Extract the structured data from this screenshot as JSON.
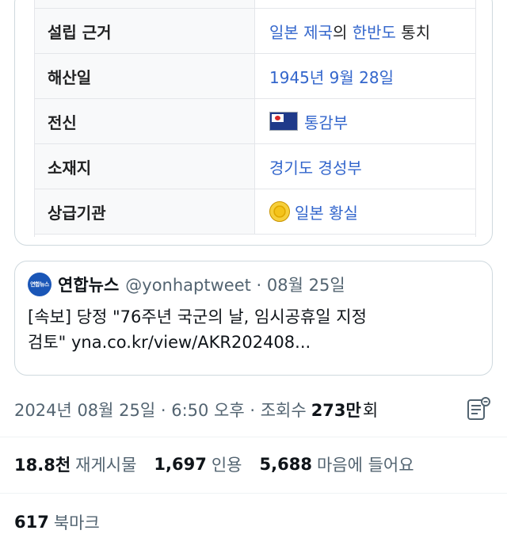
{
  "infobox": {
    "rows": [
      {
        "key": "",
        "value": ""
      },
      {
        "key": "설립 근거",
        "value_parts": [
          "일본 제국",
          "의 ",
          "한반도",
          " 통치"
        ]
      },
      {
        "key": "해산일",
        "value": "1945년 9월 28일"
      },
      {
        "key": "전신",
        "value": "통감부",
        "icon": "flag-icon"
      },
      {
        "key": "소재지",
        "value": "경기도 경성부"
      },
      {
        "key": "상급기관",
        "value": "일본 황실",
        "icon": "imperial-seal-icon"
      }
    ]
  },
  "quote_tweet": {
    "avatar_text": "연합뉴스",
    "name": "연합뉴스",
    "handle_time": "@yonhaptweet · 08월 25일",
    "text_line1": "[속보] 당정 \"76주년 국군의 날, 임시공휴일 지정",
    "text_line2": "검토\" yna.co.kr/view/AKR202408..."
  },
  "meta": {
    "datetime": "2024년 08월 25일 · 6:50 오후 · 조회수",
    "views_num": "273만",
    "views_unit": "회"
  },
  "stats": {
    "retweets_num": "18.8천",
    "retweets_label": "재게시물",
    "quotes_num": "1,697",
    "quotes_label": "인용",
    "likes_num": "5,688",
    "likes_label": "마음에 들어요"
  },
  "bookmarks": {
    "num": "617",
    "label": "북마크"
  },
  "colors": {
    "link": "#3366cc",
    "muted": "#536471",
    "text": "#0f1419",
    "border": "#cfd9de"
  }
}
